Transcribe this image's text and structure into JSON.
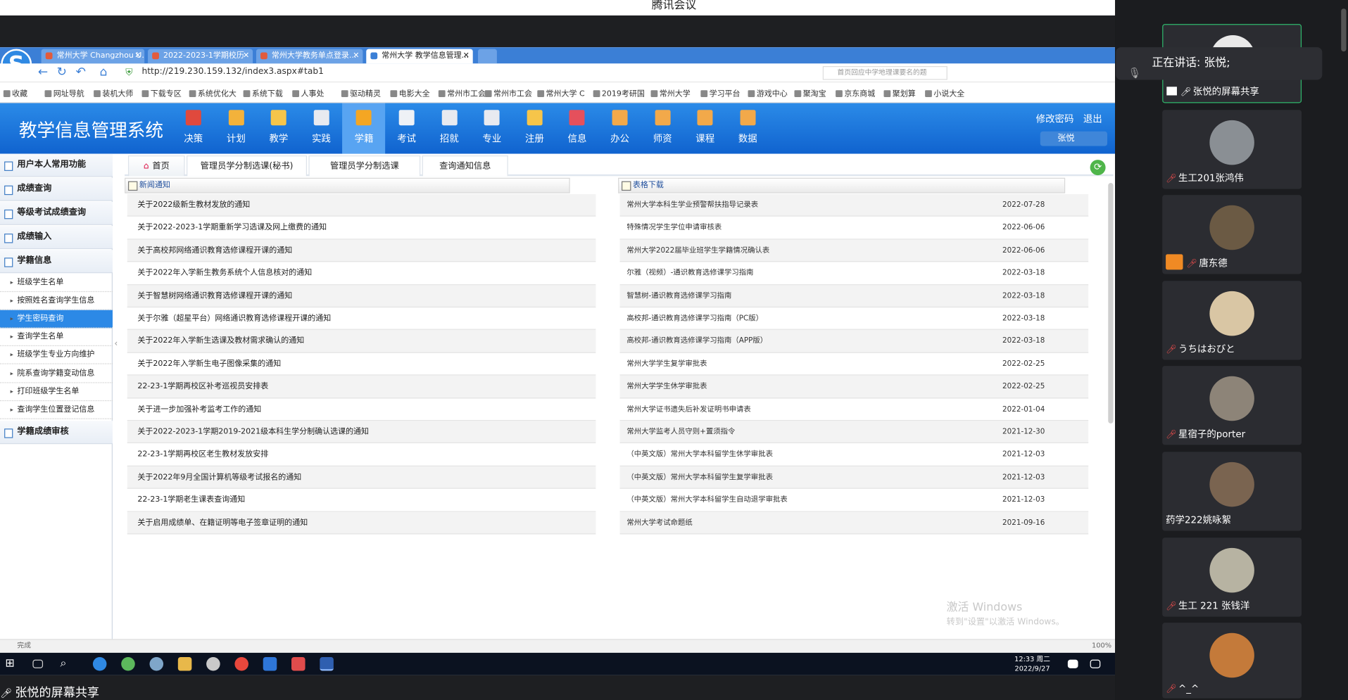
{
  "meeting": {
    "title": "腾讯会议",
    "window_controls": [
      "—",
      "⧉",
      "✕"
    ]
  },
  "browser": {
    "tabs": [
      {
        "label": "常州大学 Changzhou U..."
      },
      {
        "label": "2022-2023-1学期校历"
      },
      {
        "label": "常州大学教务单点登录..."
      },
      {
        "label": "常州大学 教学信息管理..."
      }
    ],
    "url": "http://219.230.159.132/index3.aspx#tab1",
    "search_placeholder": "首页回应中学地理课要名的题",
    "bookmarks": [
      "收藏",
      "网址导航",
      "装机大师",
      "下载专区",
      "系统优化大",
      "系统下载",
      "人事处",
      "驱动精灵",
      "电影大全",
      "常州市工会",
      "常州市工会",
      "常州大学 C",
      "2019考研国",
      "常州大学",
      "学习平台",
      "游戏中心",
      "聚淘宝",
      "京东商城",
      "聚划算",
      "小说大全"
    ],
    "status_left": "完成",
    "status_right": "100%"
  },
  "app": {
    "title": "教学信息管理系统",
    "menu": [
      {
        "label": "决策",
        "color": "#e0493d"
      },
      {
        "label": "计划",
        "color": "#f3b23b"
      },
      {
        "label": "教学",
        "color": "#f6c54a"
      },
      {
        "label": "实践",
        "color": "#e8eaf0"
      },
      {
        "label": "学籍",
        "color": "#f4a623"
      },
      {
        "label": "考试",
        "color": "#eef1f6"
      },
      {
        "label": "招就",
        "color": "#e8eaf0"
      },
      {
        "label": "专业",
        "color": "#e8eaf0"
      },
      {
        "label": "注册",
        "color": "#f6c54a"
      },
      {
        "label": "信息",
        "color": "#e5505c"
      },
      {
        "label": "办公",
        "color": "#f2a94a"
      },
      {
        "label": "师资",
        "color": "#f2a94a"
      },
      {
        "label": "课程",
        "color": "#f2a94a"
      },
      {
        "label": "数据",
        "color": "#f2a94a"
      }
    ],
    "top_links": "修改密码　退出",
    "user": "张悦"
  },
  "sidebar": {
    "groups": [
      "用户本人常用功能",
      "成绩查询",
      "等级考试成绩查询",
      "成绩输入",
      "学籍信息",
      "学籍成绩审核"
    ],
    "items": [
      "班级学生名单",
      "按照姓名查询学生信息",
      "学生密码查询",
      "查询学生名单",
      "班级学生专业方向维护",
      "院系查询学籍变动信息",
      "打印班级学生名单",
      "查询学生位置登记信息"
    ]
  },
  "content_tabs": [
    "首页",
    "管理员学分制选课(秘书)",
    "管理员学分制选课",
    "查询通知信息"
  ],
  "news": {
    "header": "新闻通知",
    "items": [
      "关于2022级新生教材发放的通知",
      "关于2022-2023-1学期重新学习选课及网上缴费的通知",
      "关于高校邦网络通识教育选修课程开课的通知",
      "关于2022年入学新生教务系统个人信息核对的通知",
      "关于智慧树网络通识教育选修课程开课的通知",
      "关于尔雅（超星平台）网络通识教育选修课程开课的通知",
      "关于2022年入学新生选课及教材需求确认的通知",
      "关于2022年入学新生电子图像采集的通知",
      "22-23-1学期再校区补考巡视员安排表",
      "关于进一步加强补考监考工作的通知",
      "关于2022-2023-1学期2019-2021级本科生学分制确认选课的通知",
      "22-23-1学期再校区老生教材发放安排",
      "关于2022年9月全国计算机等级考试报名的通知",
      "22-23-1学期老生课表查询通知",
      "关于启用成绩单、在籍证明等电子签章证明的通知"
    ]
  },
  "forms": {
    "header": "表格下载",
    "items": [
      {
        "name": "常州大学本科生学业预警帮扶指导记录表",
        "date": "2022-07-28"
      },
      {
        "name": "特殊情况学生学位申请审核表",
        "date": "2022-06-06"
      },
      {
        "name": "常州大学2022届毕业班学生学籍情况确认表",
        "date": "2022-06-06"
      },
      {
        "name": "尔雅（视频）-通识教育选修课学习指南",
        "date": "2022-03-18"
      },
      {
        "name": "智慧树-通识教育选修课学习指南",
        "date": "2022-03-18"
      },
      {
        "name": "高校邦-通识教育选修课学习指南（PC版）",
        "date": "2022-03-18"
      },
      {
        "name": "高校邦-通识教育选修课学习指南（APP版）",
        "date": "2022-03-18"
      },
      {
        "name": "常州大学学生复学审批表",
        "date": "2022-02-25"
      },
      {
        "name": "常州大学学生休学审批表",
        "date": "2022-02-25"
      },
      {
        "name": "常州大学证书遗失后补发证明书申请表",
        "date": "2022-01-04"
      },
      {
        "name": "常州大学监考人员守则+置须指令",
        "date": "2021-12-30"
      },
      {
        "name": "（中英文版）常州大学本科留学生休学审批表",
        "date": "2021-12-03"
      },
      {
        "name": "（中英文版）常州大学本科留学生复学审批表",
        "date": "2021-12-03"
      },
      {
        "name": "（中英文版）常州大学本科留学生自动退学审批表",
        "date": "2021-12-03"
      },
      {
        "name": "常州大学考试命题纸",
        "date": "2021-09-16"
      }
    ]
  },
  "watermark": {
    "line1": "激活 Windows",
    "line2": "转到\"设置\"以激活 Windows。"
  },
  "taskbar": {
    "time": "12:33 周二",
    "date": "2022/9/27"
  },
  "share_label": "张悦的屏幕共享",
  "speaking": "正在讲话: 张悦;",
  "participants": [
    {
      "name": "张悦的屏幕共享",
      "color": "#e9e9e9"
    },
    {
      "name": "生工201张鸿伟",
      "color": "#8a8f94"
    },
    {
      "name": "唐东德",
      "color": "#6b5a44"
    },
    {
      "name": "うちはおびと",
      "color": "#d9c6a4"
    },
    {
      "name": "星宿子的porter",
      "color": "#8d8478"
    },
    {
      "name": "药学222姚咏絮",
      "color": "#7a6450"
    },
    {
      "name": "生工 221 张钱洋",
      "color": "#b7b3a2"
    },
    {
      "name": "^_^",
      "color": "#c47a3a"
    }
  ]
}
